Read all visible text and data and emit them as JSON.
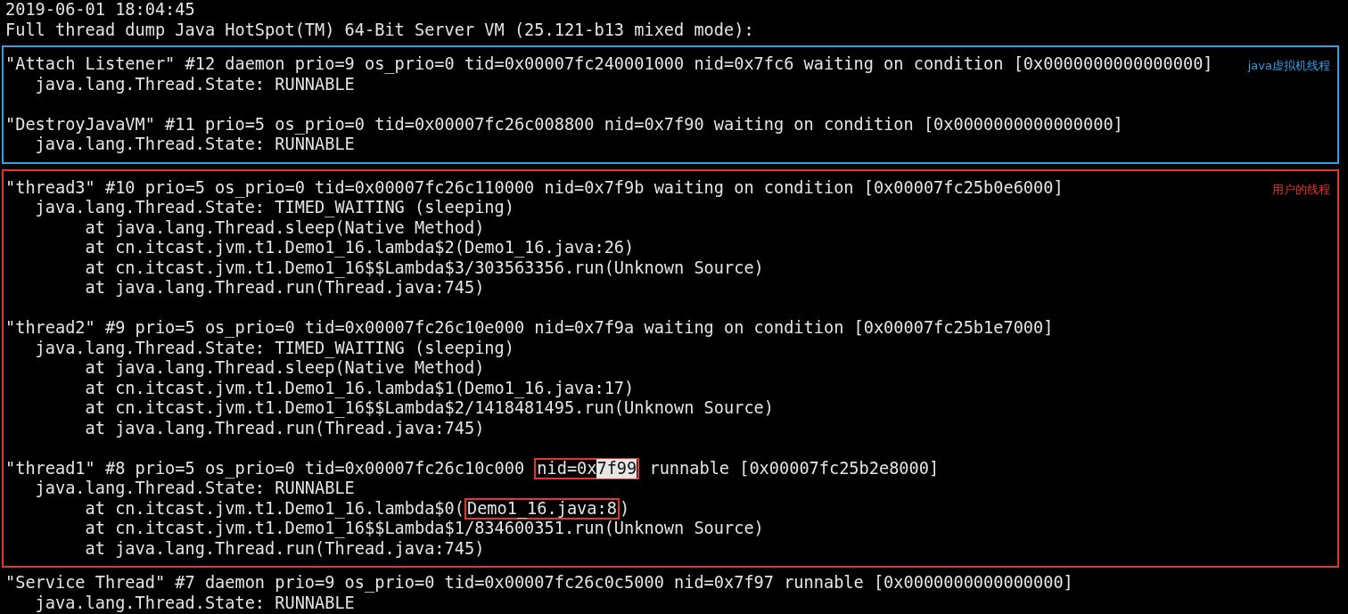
{
  "sections": [
    {
      "blocks": [
        {
          "lines": [
            [
              {
                "kind": "plain",
                "text": "2019-06-01 18:04:45"
              }
            ],
            [
              {
                "kind": "plain",
                "text": "Full thread dump Java HotSpot(TM) 64-Bit Server VM (25.121-b13 mixed mode):"
              }
            ]
          ]
        }
      ]
    },
    {
      "color": "#2f9fe6",
      "note": "java虚拟机线程",
      "blocks": [
        {
          "lines": [
            [
              {
                "kind": "plain",
                "text": "\"Attach Listener\" #12 daemon prio=9 os_prio=0 tid=0x00007fc240001000 nid=0x7fc6 waiting on condition [0x0000000000000000]"
              }
            ],
            [
              {
                "kind": "plain",
                "text": "   java.lang.Thread.State: RUNNABLE"
              }
            ]
          ]
        },
        {
          "lines": [
            [
              {
                "kind": "plain",
                "text": "\"DestroyJavaVM\" #11 prio=5 os_prio=0 tid=0x00007fc26c008800 nid=0x7f90 waiting on condition [0x0000000000000000]"
              }
            ],
            [
              {
                "kind": "plain",
                "text": "   java.lang.Thread.State: RUNNABLE"
              }
            ]
          ]
        }
      ]
    },
    {
      "color": "#e8322a",
      "note": "用户的线程",
      "blocks": [
        {
          "lines": [
            [
              {
                "kind": "plain",
                "text": "\"thread3\" #10 prio=5 os_prio=0 tid=0x00007fc26c110000 nid=0x7f9b waiting on condition [0x00007fc25b0e6000]"
              }
            ],
            [
              {
                "kind": "plain",
                "text": "   java.lang.Thread.State: TIMED_WAITING (sleeping)"
              }
            ],
            [
              {
                "kind": "plain",
                "text": "        at java.lang.Thread.sleep(Native Method)"
              }
            ],
            [
              {
                "kind": "plain",
                "text": "        at cn.itcast.jvm.t1.Demo1_16.lambda$2(Demo1_16.java:26)"
              }
            ],
            [
              {
                "kind": "plain",
                "text": "        at cn.itcast.jvm.t1.Demo1_16$$Lambda$3/303563356.run(Unknown Source)"
              }
            ],
            [
              {
                "kind": "plain",
                "text": "        at java.lang.Thread.run(Thread.java:745)"
              }
            ]
          ]
        },
        {
          "lines": [
            [
              {
                "kind": "plain",
                "text": "\"thread2\" #9 prio=5 os_prio=0 tid=0x00007fc26c10e000 nid=0x7f9a waiting on condition [0x00007fc25b1e7000]"
              }
            ],
            [
              {
                "kind": "plain",
                "text": "   java.lang.Thread.State: TIMED_WAITING (sleeping)"
              }
            ],
            [
              {
                "kind": "plain",
                "text": "        at java.lang.Thread.sleep(Native Method)"
              }
            ],
            [
              {
                "kind": "plain",
                "text": "        at cn.itcast.jvm.t1.Demo1_16.lambda$1(Demo1_16.java:17)"
              }
            ],
            [
              {
                "kind": "plain",
                "text": "        at cn.itcast.jvm.t1.Demo1_16$$Lambda$2/1418481495.run(Unknown Source)"
              }
            ],
            [
              {
                "kind": "plain",
                "text": "        at java.lang.Thread.run(Thread.java:745)"
              }
            ]
          ]
        },
        {
          "lines": [
            [
              {
                "kind": "plain",
                "text": "\"thread1\" #8 prio=5 os_prio=0 tid=0x00007fc26c10c000 "
              },
              {
                "kind": "boxed",
                "segments": [
                  {
                    "text": "nid=0x",
                    "selected": false
                  },
                  {
                    "text": "7f99",
                    "selected": true
                  }
                ]
              },
              {
                "kind": "plain",
                "text": " runnable [0x00007fc25b2e8000]"
              }
            ],
            [
              {
                "kind": "plain",
                "text": "   java.lang.Thread.State: RUNNABLE"
              }
            ],
            [
              {
                "kind": "plain",
                "text": "        at cn.itcast.jvm.t1.Demo1_16.lambda$0("
              },
              {
                "kind": "boxed",
                "segments": [
                  {
                    "text": "Demo1_16.java:8",
                    "selected": false
                  }
                ]
              },
              {
                "kind": "plain",
                "text": ")"
              }
            ],
            [
              {
                "kind": "plain",
                "text": "        at cn.itcast.jvm.t1.Demo1_16$$Lambda$1/834600351.run(Unknown Source)"
              }
            ],
            [
              {
                "kind": "plain",
                "text": "        at java.lang.Thread.run(Thread.java:745)"
              }
            ]
          ]
        }
      ]
    },
    {
      "blocks": [
        {
          "lines": [
            [
              {
                "kind": "plain",
                "text": "\"Service Thread\" #7 daemon prio=9 os_prio=0 tid=0x00007fc26c0c5000 nid=0x7f97 runnable [0x0000000000000000]"
              }
            ],
            [
              {
                "kind": "plain",
                "text": "   java.lang.Thread.State: RUNNABLE"
              }
            ]
          ]
        }
      ]
    }
  ]
}
